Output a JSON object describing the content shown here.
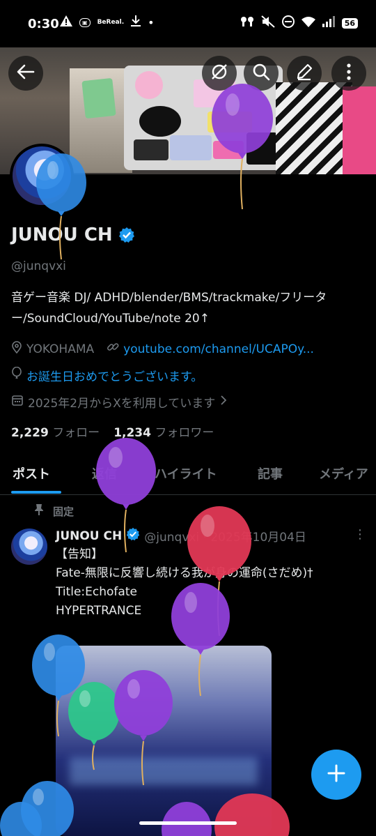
{
  "status_bar": {
    "time": "0:30",
    "bereal": "BeReal.",
    "battery": "56",
    "icons": [
      "warning-icon",
      "app-icon",
      "download-icon",
      "dot-icon",
      "earbuds-icon",
      "mute-icon",
      "dnd-icon",
      "wifi-icon",
      "signal-icon",
      "battery-icon"
    ]
  },
  "banner": {
    "buttons": [
      "back-arrow-icon",
      "grok-icon",
      "search-icon",
      "edit-icon",
      "more-vertical-icon"
    ]
  },
  "profile": {
    "name": "JUNOU CH",
    "handle": "@junqvxi",
    "bio": "音ゲー音楽 DJ/ ADHD/blender/BMS/trackmake/フリーター/SoundCloud/YouTube/note 20↑",
    "location": "YOKOHAMA",
    "website": "youtube.com/channel/UCAPOy...",
    "birthday": "お誕生日おめでとうございます。",
    "joined": "2025年2月からXを利用しています",
    "following_count": "2,229",
    "following_label": "フォロー",
    "followers_count": "1,234",
    "followers_label": "フォロワー"
  },
  "tabs": [
    "ポスト",
    "返信",
    "ハイライト",
    "記事",
    "メディア"
  ],
  "post": {
    "pinned_label": "固定",
    "author": "JUNOU CH",
    "handle_date": "@junqvxi · 2025年10月04日",
    "lines": [
      "【告知】",
      "Fate-無限に反響し続ける我が身の運命(さだめ)†",
      "Title:Echofate",
      "HYPERTRANCE"
    ]
  },
  "colors": {
    "accent": "#1d9bf0",
    "background": "#000000",
    "text": "#e7e9ea",
    "muted": "#71767b"
  }
}
